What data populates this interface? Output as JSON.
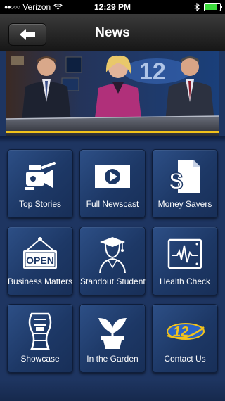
{
  "status": {
    "carrier": "Verizon",
    "time": "12:29 PM"
  },
  "header": {
    "title": "News"
  },
  "tiles": [
    {
      "label": "Top Stories",
      "icon": "video-camera-icon"
    },
    {
      "label": "Full Newscast",
      "icon": "play-icon"
    },
    {
      "label": "Money Savers",
      "icon": "money-document-icon"
    },
    {
      "label": "Business Matters",
      "icon": "open-sign-icon"
    },
    {
      "label": "Standout Student",
      "icon": "graduate-icon"
    },
    {
      "label": "Health Check",
      "icon": "heartbeat-monitor-icon"
    },
    {
      "label": "Showcase",
      "icon": "film-strip-icon"
    },
    {
      "label": "In the Garden",
      "icon": "plant-icon"
    },
    {
      "label": "Contact Us",
      "icon": "channel-12-logo-icon"
    }
  ],
  "hero": {
    "logo_text": "12"
  },
  "icons": {
    "open_sign": "OPEN",
    "logo": "12"
  },
  "colors": {
    "accent_gold": "#f2c21b",
    "logo_blue": "#2a63c7",
    "tile_blue": "#2d4f86"
  }
}
